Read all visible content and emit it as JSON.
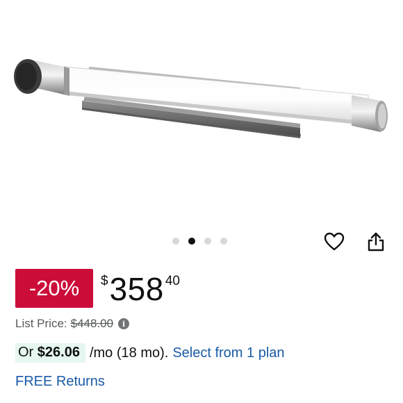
{
  "product": {
    "image_alt": "Vanity light bar fixture"
  },
  "carousel": {
    "total": 4,
    "active_index": 1
  },
  "actions": {
    "wishlist_icon": "heart-icon",
    "share_icon": "share-icon"
  },
  "pricing": {
    "discount": "-20%",
    "currency_symbol": "$",
    "price_whole": "358",
    "price_fraction": "40",
    "list_price_label": "List Price:",
    "list_price_value": "$448.00",
    "info_icon": "i"
  },
  "installment": {
    "prefix": "Or",
    "amount": "$26.06",
    "term": "/mo (18 mo).",
    "link": "Select from 1 plan"
  },
  "returns": {
    "label": "FREE Returns"
  },
  "colors": {
    "discount_badge": "#cc0c39",
    "link": "#1a5aa6",
    "installment_highlight": "#e6f7ef"
  }
}
